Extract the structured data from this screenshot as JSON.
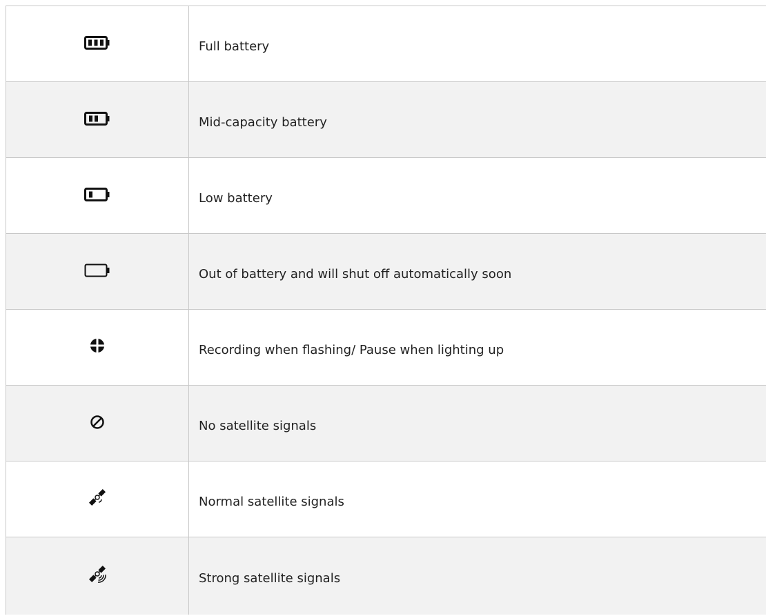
{
  "rows": [
    {
      "icon": "battery-full-icon",
      "description": "Full battery"
    },
    {
      "icon": "battery-mid-icon",
      "description": "Mid-capacity battery"
    },
    {
      "icon": "battery-low-icon",
      "description": "Low battery"
    },
    {
      "icon": "battery-empty-icon",
      "description": "Out of battery and will shut off automatically soon"
    },
    {
      "icon": "recording-icon",
      "description": "Recording when flashing/ Pause when lighting up"
    },
    {
      "icon": "no-signal-icon",
      "description": "No satellite signals"
    },
    {
      "icon": "satellite-normal-icon",
      "description": "Normal satellite signals"
    },
    {
      "icon": "satellite-strong-icon",
      "description": "Strong satellite signals"
    }
  ],
  "colors": {
    "border": "#c8c8c8",
    "shaded_row": "#f2f2f2",
    "icon": "#111111"
  }
}
